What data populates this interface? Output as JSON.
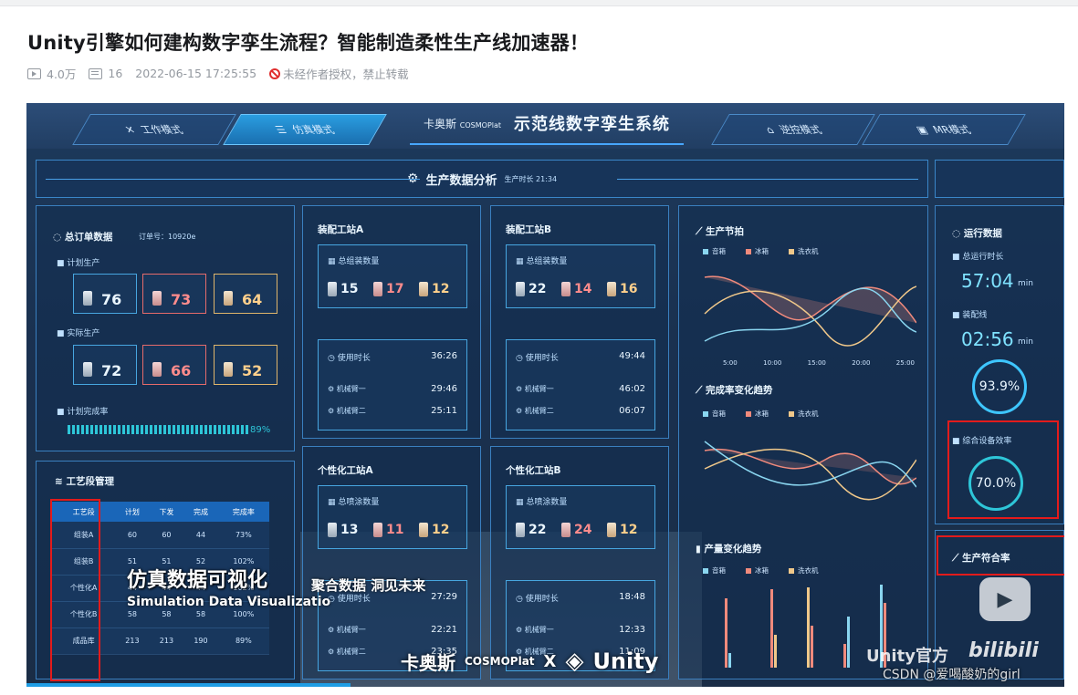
{
  "page": {
    "title": "Unity引擎如何建构数字孪生流程？智能制造柔性生产线加速器！",
    "views": "4.0万",
    "danmaku": "16",
    "datetime": "2022-06-15 17:25:55",
    "copyright": "未经作者授权，禁止转载"
  },
  "dashboard": {
    "tabs": [
      "工作模式",
      "仿真模式",
      "逆控模式",
      "MR模式"
    ],
    "brand": "卡奥斯",
    "brand_en": "COSMOPlat",
    "system_name": "示范线数字孪生系统",
    "banner_title": "生产数据分析",
    "banner_sub": "生产时长 21:34",
    "orders": {
      "title": "总订单数据",
      "order_no": "订单号：10920e",
      "plan_label": "计划生产",
      "actual_label": "实际生产",
      "rate_label": "计划完成率",
      "rate_value": "89%",
      "plan": [
        "76",
        "73",
        "64"
      ],
      "actual": [
        "72",
        "66",
        "52"
      ],
      "types": [
        "音箱",
        "冰箱",
        "洗衣机"
      ]
    },
    "stationA": {
      "title": "装配工站A",
      "sub": "总组装数量",
      "counts": [
        "15",
        "17",
        "12"
      ],
      "usage": "使用时长",
      "usage_val": "36:26",
      "arm1": "机械臂一",
      "arm1_val": "29:46",
      "arm2": "机械臂二",
      "arm2_val": "25:11"
    },
    "stationB": {
      "title": "装配工站B",
      "sub": "总组装数量",
      "counts": [
        "22",
        "14",
        "16"
      ],
      "usage": "使用时长",
      "usage_val": "49:44",
      "arm1": "机械臂一",
      "arm1_val": "46:02",
      "arm2": "机械臂二",
      "arm2_val": "06:07"
    },
    "customA": {
      "title": "个性化工站A",
      "sub": "总喷涂数量",
      "counts": [
        "13",
        "11",
        "12"
      ],
      "usage": "使用时长",
      "usage_val": "27:29",
      "arm1": "机械臂一",
      "arm1_val": "22:21",
      "arm2": "机械臂二",
      "arm2_val": "23:35"
    },
    "customB": {
      "title": "个性化工站B",
      "sub": "总喷涂数量",
      "counts": [
        "22",
        "24",
        "12"
      ],
      "usage": "使用时长",
      "usage_val": "18:48",
      "arm1": "机械臂一",
      "arm1_val": "12:33",
      "arm2": "机械臂二",
      "arm2_val": "11:09"
    },
    "process": {
      "title": "工艺段管理",
      "headers": [
        "工艺段",
        "计划",
        "下发",
        "完成",
        "完成率"
      ],
      "rows": [
        [
          "组装A",
          "60",
          "60",
          "44",
          "73%"
        ],
        [
          "组装B",
          "51",
          "51",
          "52",
          "102%"
        ],
        [
          "个性化A",
          "44",
          "44",
          "44",
          "102%"
        ],
        [
          "个性化B",
          "58",
          "58",
          "58",
          "100%"
        ],
        [
          "成品库",
          "213",
          "213",
          "190",
          "89%"
        ]
      ]
    },
    "charts": {
      "beat_title": "生产节拍",
      "trend_title": "完成率变化趋势",
      "output_title": "产量变化趋势",
      "legend": [
        "音箱",
        "冰箱",
        "洗衣机"
      ],
      "xticks": [
        "5:00",
        "10:00",
        "15:00",
        "20:00",
        "25:00"
      ]
    },
    "runtime": {
      "title": "运行数据",
      "total_label": "总运行时长",
      "total_val": "57:04",
      "unit": "min",
      "line_label": "装配线",
      "line_val": "02:56",
      "pct": "93.9%",
      "oee_label": "综合设备效率",
      "oee_val": "70.0%",
      "conform_label": "生产符合率"
    },
    "overlay": {
      "cn": "仿真数据可视化",
      "cn2": "聚合数据 洞见未来",
      "en": "Simulation Data Visualizatio",
      "logo_x": "X",
      "unity": "Unity",
      "wm_unity": "Unity官方",
      "wm_bili": "bilibili",
      "csdn": "CSDN @爱喝酸奶的girl"
    }
  }
}
